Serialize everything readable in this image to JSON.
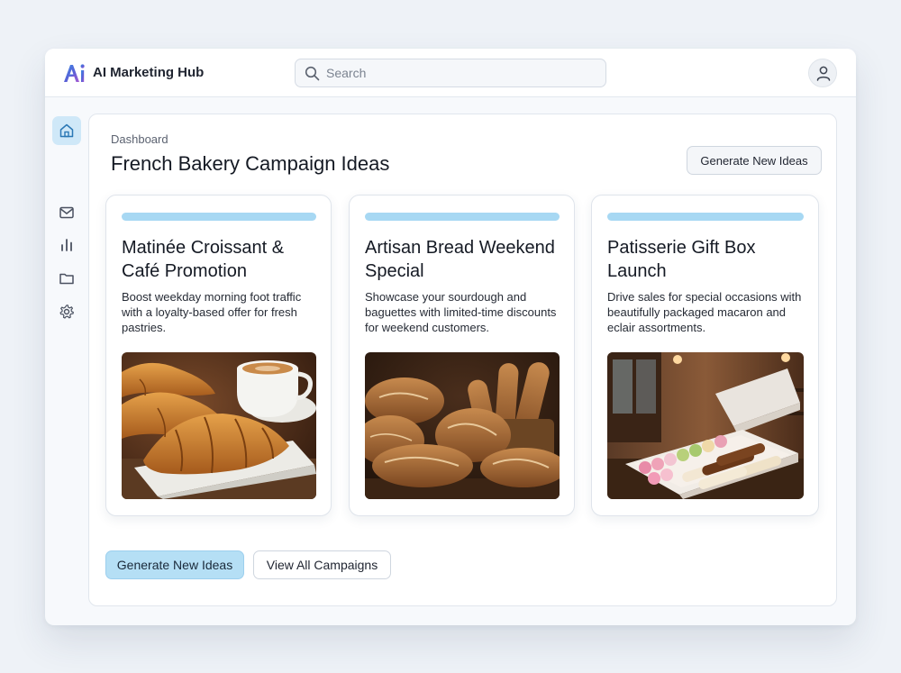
{
  "app": {
    "title": "AI Marketing Hub",
    "logo_text": "AI"
  },
  "search": {
    "placeholder": "Search",
    "value": ""
  },
  "sidebar": {
    "items": [
      {
        "icon": "home-icon",
        "active": true
      },
      {
        "icon": "mail-icon",
        "active": false
      },
      {
        "icon": "chart-icon",
        "active": false
      },
      {
        "icon": "folder-icon",
        "active": false
      },
      {
        "icon": "gear-icon",
        "active": false
      }
    ]
  },
  "main": {
    "breadcrumb": "Dashboard",
    "title": "French Bakery Campaign Ideas",
    "generate_top_label": "Generate New Ideas",
    "cards": [
      {
        "title": "Matinée Croissant & Café Promotion",
        "description": "Boost weekday morning foot traffic with a loyalty-based offer for fresh pastries.",
        "image": "croissants-and-coffee"
      },
      {
        "title": "Artisan Bread Weekend Special",
        "description": "Showcase your sourdough and baguettes with limited-time discounts for weekend customers.",
        "image": "artisan-bread-loaves"
      },
      {
        "title": "Patisserie Gift Box Launch",
        "description": "Drive sales for special occasions with beautifully packaged macaron and eclair assortments.",
        "image": "macaron-eclair-gift-box"
      }
    ],
    "primary_button": "Generate New Ideas",
    "secondary_button": "View All Campaigns"
  },
  "colors": {
    "accent": "#a7d8f3",
    "primary_button": "#b5dff5",
    "active_nav": "#cfe8f8",
    "background": "#eef2f7"
  }
}
